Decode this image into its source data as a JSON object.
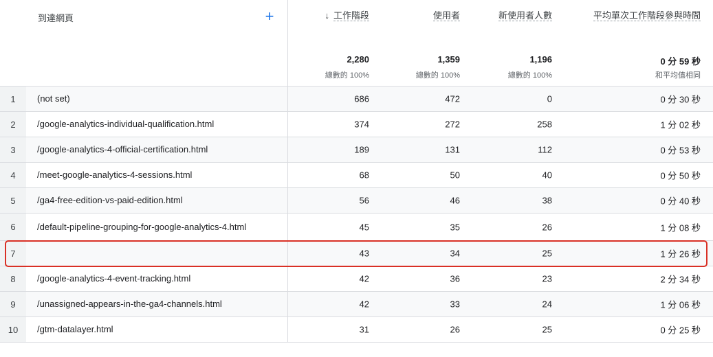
{
  "table": {
    "dimension_header": "到達網頁",
    "add_icon": "plus-icon",
    "add_label": "+",
    "sort_icon": "arrow-down-icon",
    "sort_glyph": "↓",
    "columns": [
      {
        "key": "sessions",
        "title": "工作階段",
        "total": "2,280",
        "sub": "總數的 100%"
      },
      {
        "key": "users",
        "title": "使用者",
        "total": "1,359",
        "sub": "總數的 100%"
      },
      {
        "key": "newusers",
        "title": "新使用者人數",
        "total": "1,196",
        "sub": "總數的 100%"
      },
      {
        "key": "avgtime",
        "title": "平均單次工作階段參與時間",
        "total": "0 分 59 秒",
        "sub": "和平均值相同"
      }
    ],
    "rows": [
      {
        "index": "1",
        "page": "(not set)",
        "sessions": "686",
        "users": "472",
        "newusers": "0",
        "avgtime": "0 分 30 秒"
      },
      {
        "index": "2",
        "page": "/google-analytics-individual-qualification.html",
        "sessions": "374",
        "users": "272",
        "newusers": "258",
        "avgtime": "1 分 02 秒"
      },
      {
        "index": "3",
        "page": "/google-analytics-4-official-certification.html",
        "sessions": "189",
        "users": "131",
        "newusers": "112",
        "avgtime": "0 分 53 秒"
      },
      {
        "index": "4",
        "page": "/meet-google-analytics-4-sessions.html",
        "sessions": "68",
        "users": "50",
        "newusers": "40",
        "avgtime": "0 分 50 秒"
      },
      {
        "index": "5",
        "page": "/ga4-free-edition-vs-paid-edition.html",
        "sessions": "56",
        "users": "46",
        "newusers": "38",
        "avgtime": "0 分 40 秒"
      },
      {
        "index": "6",
        "page": "/default-pipeline-grouping-for-google-analytics-4.html",
        "sessions": "45",
        "users": "35",
        "newusers": "26",
        "avgtime": "1 分 08 秒"
      },
      {
        "index": "7",
        "page": "",
        "sessions": "43",
        "users": "34",
        "newusers": "25",
        "avgtime": "1 分 26 秒"
      },
      {
        "index": "8",
        "page": "/google-analytics-4-event-tracking.html",
        "sessions": "42",
        "users": "36",
        "newusers": "23",
        "avgtime": "2 分 34 秒"
      },
      {
        "index": "9",
        "page": "/unassigned-appears-in-the-ga4-channels.html",
        "sessions": "42",
        "users": "33",
        "newusers": "24",
        "avgtime": "1 分 06 秒"
      },
      {
        "index": "10",
        "page": "/gtm-datalayer.html",
        "sessions": "31",
        "users": "26",
        "newusers": "25",
        "avgtime": "0 分 25 秒"
      }
    ],
    "highlight_color": "#d93025",
    "accent_color": "#1a73e8"
  }
}
